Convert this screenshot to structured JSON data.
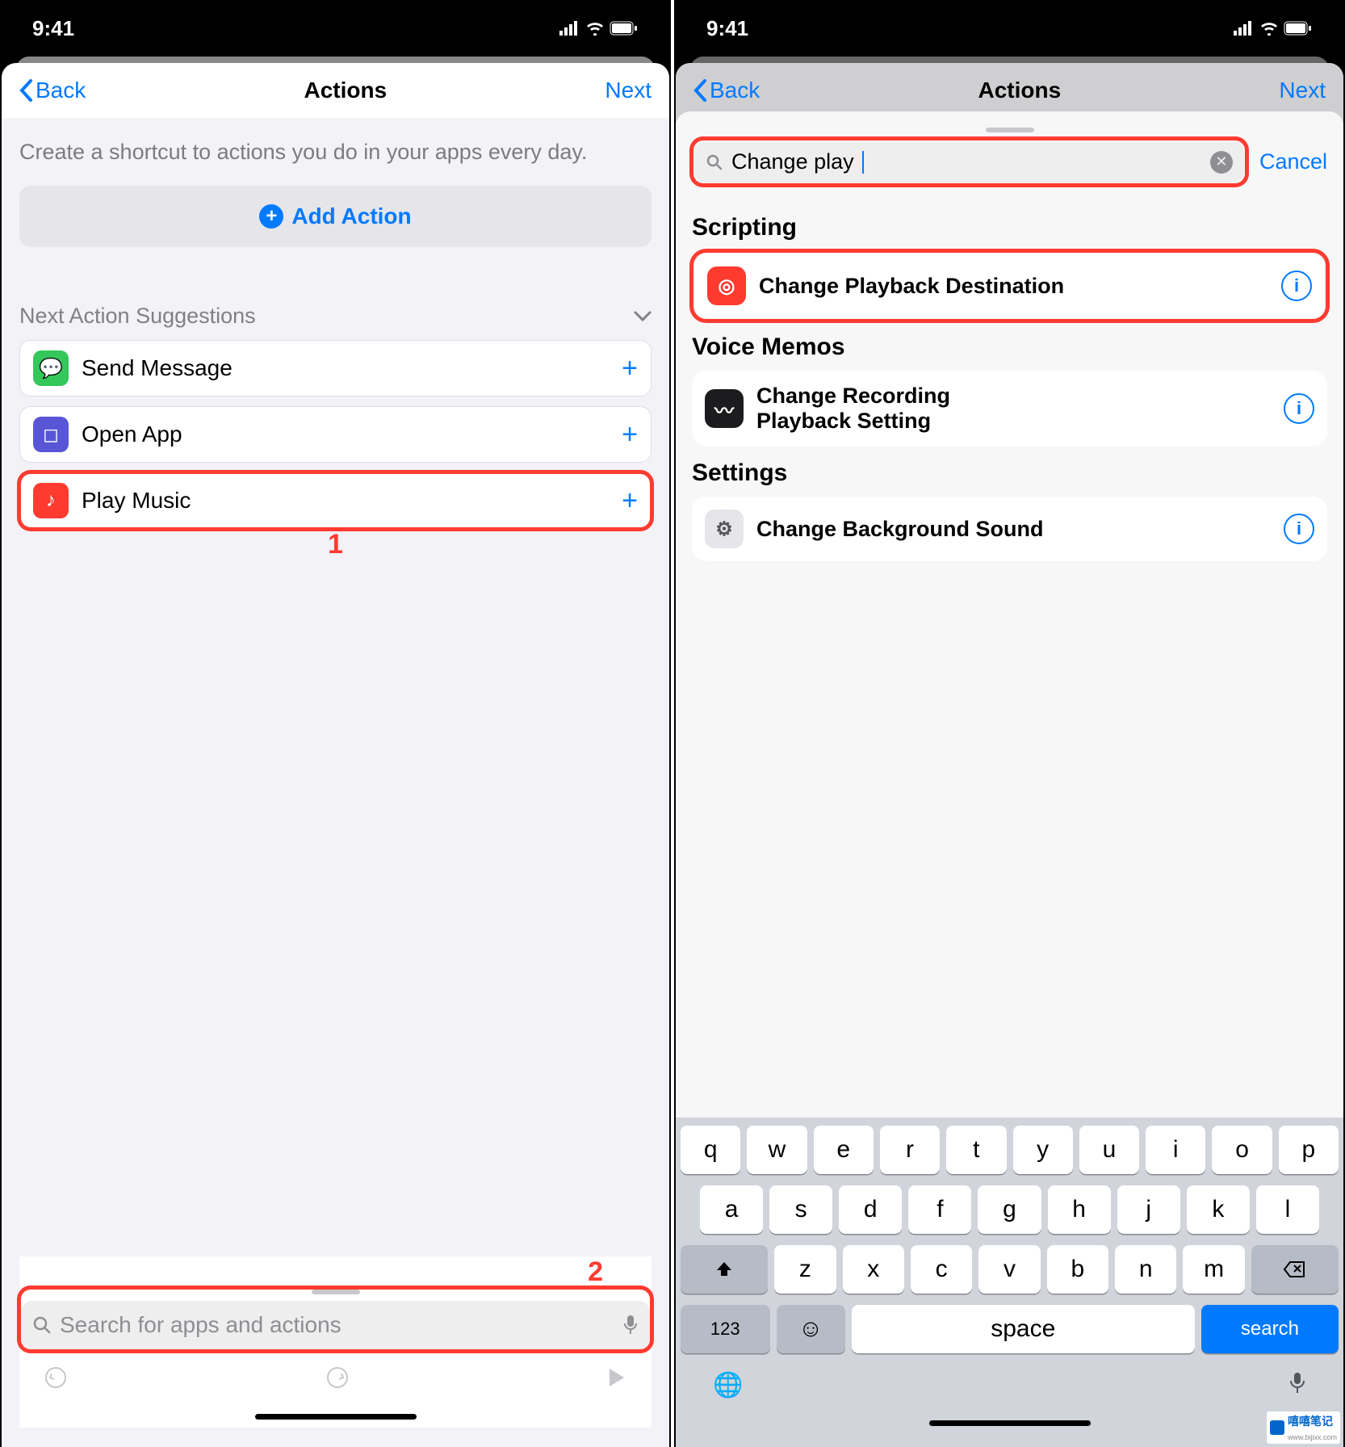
{
  "status": {
    "time": "9:41"
  },
  "nav": {
    "back": "Back",
    "title": "Actions",
    "next": "Next"
  },
  "left": {
    "desc": "Create a shortcut to actions you do in your apps every day.",
    "add": "Add Action",
    "sect_title": "Next Action Suggestions",
    "items": [
      {
        "label": "Send Message",
        "color": "#34c759"
      },
      {
        "label": "Open App",
        "color": "#5856d6"
      },
      {
        "label": "Play Music",
        "color": "#ff3b30"
      }
    ],
    "c1": "1",
    "c2": "2",
    "search_ph": "Search for apps and actions"
  },
  "right": {
    "search_val": "Change play",
    "cancel": "Cancel",
    "cats": [
      {
        "title": "Scripting",
        "item": "Change Playback Destination",
        "color": "#ff3b30",
        "hl": true
      },
      {
        "title": "Voice Memos",
        "item": "Change Recording Playback Setting",
        "color": "#1c1c1e"
      },
      {
        "title": "Settings",
        "item": "Change Background Sound",
        "color": "#8e8e93"
      }
    ]
  },
  "kb": {
    "r1": [
      "q",
      "w",
      "e",
      "r",
      "t",
      "y",
      "u",
      "i",
      "o",
      "p"
    ],
    "r2": [
      "a",
      "s",
      "d",
      "f",
      "g",
      "h",
      "j",
      "k",
      "l"
    ],
    "r3": [
      "z",
      "x",
      "c",
      "v",
      "b",
      "n",
      "m"
    ],
    "n123": "123",
    "space": "space",
    "search": "search"
  },
  "wm": {
    "name": "嘻嘻笔记",
    "url": "www.bijixx.com"
  }
}
